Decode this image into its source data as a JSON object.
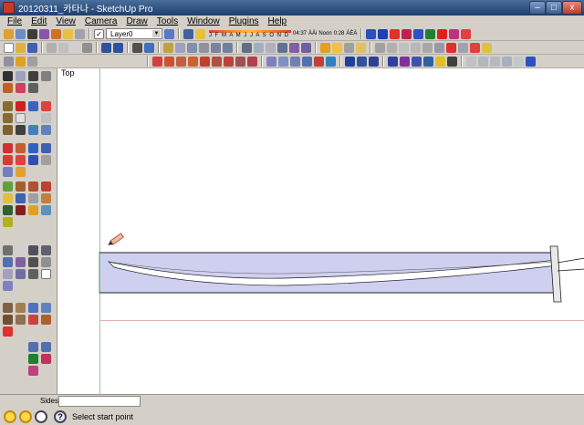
{
  "window": {
    "title": "20120311_카타나 - SketchUp Pro",
    "minimize_glyph": "–",
    "maximize_glyph": "□",
    "close_glyph": "x"
  },
  "menu": [
    "File",
    "Edit",
    "View",
    "Camera",
    "Draw",
    "Tools",
    "Window",
    "Plugins",
    "Help"
  ],
  "toolbar": {
    "layer": "Layer0",
    "months": "J F M A M J J A S O N D",
    "time_start": "04:37",
    "time_start_suffix": "ÀÀi",
    "noon": "Noon",
    "time_end": "0:28",
    "time_end_suffix": "ÀÈÄ"
  },
  "viewport": {
    "label": "Top",
    "blade_color": "#cfd0f0",
    "edge_color": "#202020"
  },
  "sides_label": "Sides",
  "status": {
    "help_glyph": "?",
    "text": "Select start point"
  },
  "icons": [
    "select-arrow-icon",
    "eraser-icon",
    "paint-bucket-icon",
    "line-icon",
    "arc-icon",
    "rectangle-icon",
    "circle-icon",
    "push-pull-icon",
    "move-icon",
    "rotate-icon",
    "scale-icon",
    "offset-icon",
    "tape-measure-icon",
    "text-icon",
    "axes-icon",
    "orbit-icon",
    "pan-icon",
    "zoom-icon",
    "walk-icon",
    "look-around-icon",
    "section-plane-icon"
  ],
  "colors": {
    "titlebar": "#1e3f6e",
    "viewport_bg": "#ffffff",
    "green_axis": "#9cc79a",
    "red_axis": "#e5b3b3"
  }
}
